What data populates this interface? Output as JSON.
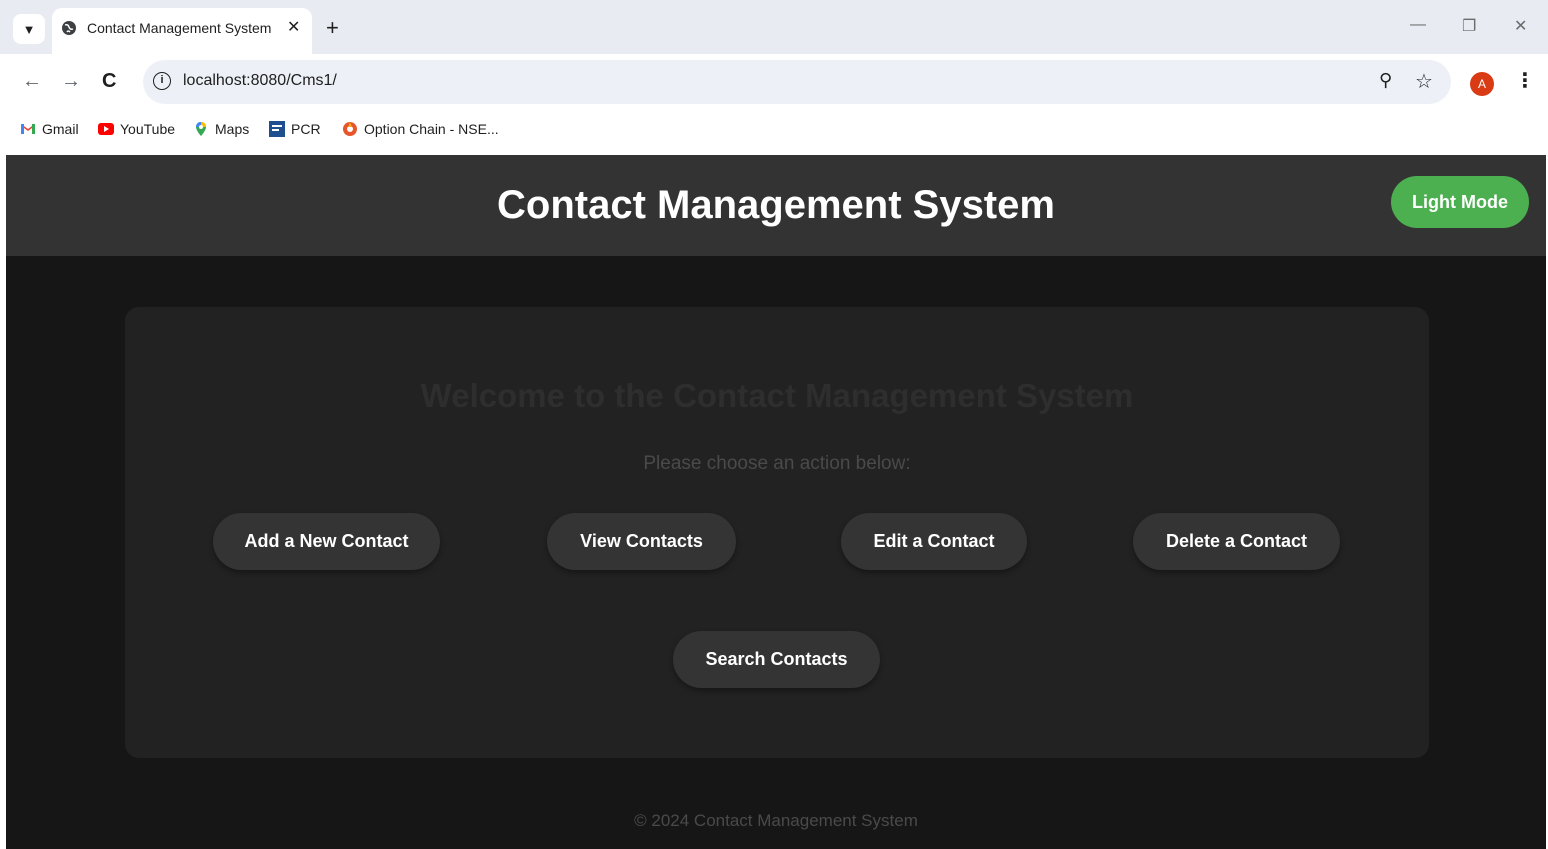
{
  "browser": {
    "tab_title": "Contact Management System",
    "url": "localhost:8080/Cms1/",
    "avatar_letter": "A",
    "bookmarks": [
      {
        "label": "Gmail",
        "icon": "gmail-icon"
      },
      {
        "label": "YouTube",
        "icon": "youtube-icon"
      },
      {
        "label": "Maps",
        "icon": "maps-icon"
      },
      {
        "label": "PCR",
        "icon": "pcr-icon"
      },
      {
        "label": "Option Chain - NSE...",
        "icon": "option-chain-icon"
      }
    ],
    "colors": {
      "tabstrip": "#e8ecf2",
      "omnibox": "#edf1f7",
      "avatar": "#d93b14"
    }
  },
  "page": {
    "header_title": "Contact Management System",
    "mode_toggle_label": "Light Mode",
    "welcome_heading": "Welcome to the Contact Management System",
    "subtitle": "Please choose an action below:",
    "actions": [
      {
        "label": "Add a New Contact"
      },
      {
        "label": "View Contacts"
      },
      {
        "label": "Edit a Contact"
      },
      {
        "label": "Delete a Contact"
      },
      {
        "label": "Search Contacts"
      }
    ],
    "footer": "© 2024 Contact Management System",
    "colors": {
      "background": "#161616",
      "header": "#333333",
      "card": "#222222",
      "button": "#343434",
      "accent": "#4caf50"
    }
  }
}
